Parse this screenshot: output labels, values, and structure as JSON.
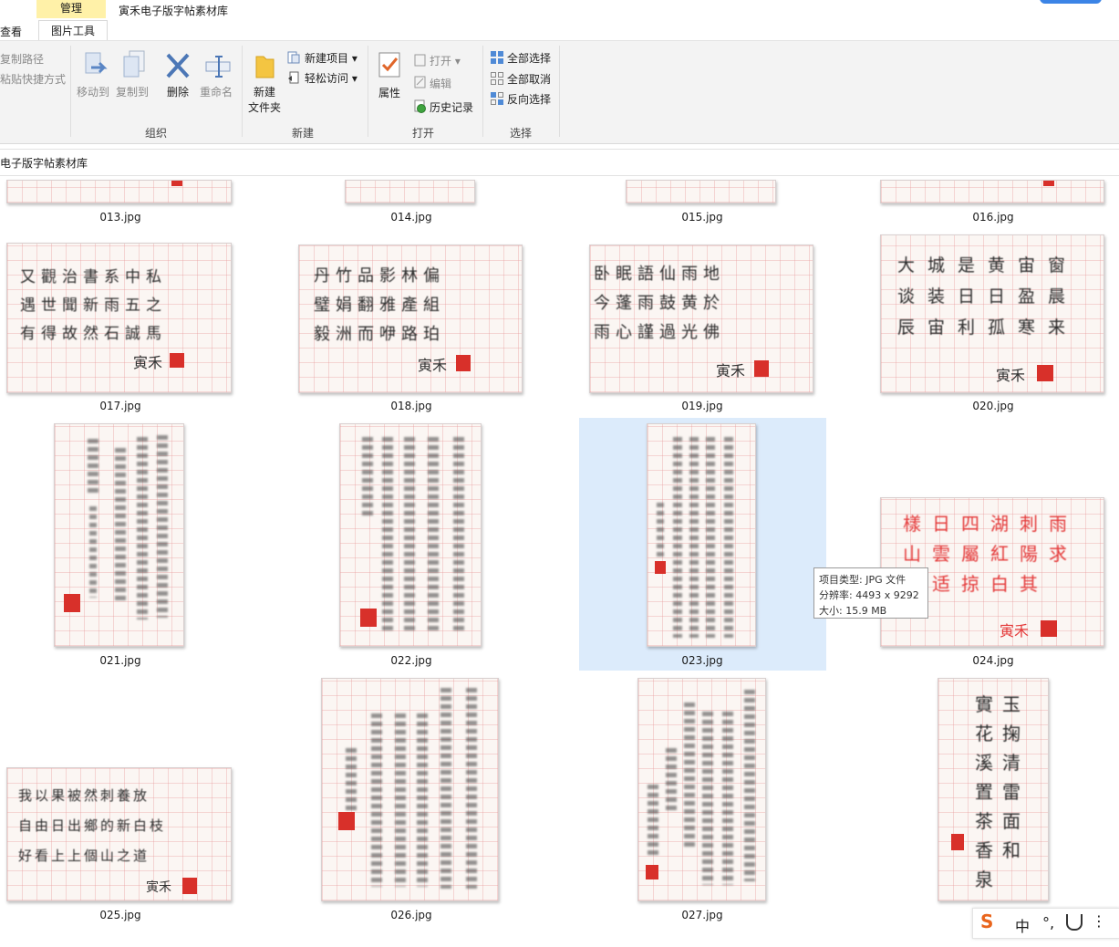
{
  "titlebar": {
    "manage_tab": "管理",
    "window_title": "寅禾电子版字帖素材库",
    "view_tab": "查看",
    "picture_tools_tab": "图片工具"
  },
  "ribbon": {
    "clipboard": {
      "copy_path": "复制路径",
      "paste_shortcut": "粘贴快捷方式"
    },
    "organize": {
      "move_to": "移动到",
      "copy_to": "复制到",
      "delete": "删除",
      "rename": "重命名",
      "group_label": "组织"
    },
    "new": {
      "new_folder_line1": "新建",
      "new_folder_line2": "文件夹",
      "new_item": "新建项目",
      "easy_access": "轻松访问",
      "group_label": "新建"
    },
    "open": {
      "properties": "属性",
      "open": "打开",
      "edit": "编辑",
      "history": "历史记录",
      "group_label": "打开"
    },
    "select": {
      "select_all": "全部选择",
      "select_none": "全部取消",
      "invert_selection": "反向选择",
      "group_label": "选择"
    }
  },
  "address": {
    "path": "电子版字帖素材库"
  },
  "files": {
    "f013": "013.jpg",
    "f014": "014.jpg",
    "f015": "015.jpg",
    "f016": "016.jpg",
    "f017": "017.jpg",
    "f018": "018.jpg",
    "f019": "019.jpg",
    "f020": "020.jpg",
    "f021": "021.jpg",
    "f022": "022.jpg",
    "f023": "023.jpg",
    "f024": "024.jpg",
    "f025": "025.jpg",
    "f026": "026.jpg",
    "f027": "027.jpg"
  },
  "thumb_text": {
    "t017": [
      "又觀治書系中私",
      "遇世聞新雨五之",
      "有得故然石誠馬"
    ],
    "t018": [
      "丹竹品影林偏",
      "璧娟翻雅產組",
      "毅洲而咿路珀"
    ],
    "t019": [
      "卧眠語仙雨地",
      "今蓬雨鼓黄於",
      "雨心謹過光佛"
    ],
    "t020": [
      "大城是黄宙窗",
      "谈装日日盈晨",
      "辰宙利孤寒来"
    ],
    "t024": [
      "樣日四湖刺雨",
      "山雲屬紅陽求",
      "東适掠白其"
    ],
    "t025": [
      "我以果被然刺養放",
      "自由日出鄉的新白枝",
      "好看上上個山之道"
    ],
    "t028": [
      "實玉",
      "花掬",
      "溪清",
      "置雷",
      "茶面",
      "香和",
      "泉"
    ],
    "signature": "寅禾"
  },
  "tooltip": {
    "type": "项目类型: JPG 文件",
    "resolution": "分辨率: 4493 x 9292",
    "size": "大小: 15.9 MB"
  },
  "ime": {
    "logo": "S",
    "mode": "中",
    "punct": "°,"
  },
  "colors": {
    "selection": "#dcebfb",
    "manage_tab": "#fff1a8",
    "seal": "#d8302a",
    "accent": "#3b84e6"
  }
}
